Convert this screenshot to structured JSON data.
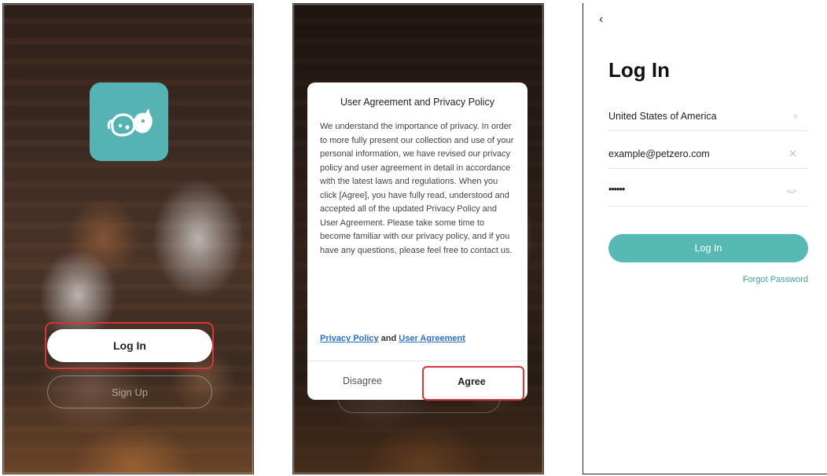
{
  "screens": {
    "welcome": {
      "login_label": "Log In",
      "signup_label": "Sign Up",
      "highlight_color": "#d4363c",
      "logo_color": "#56b3b4",
      "logo_icon": "dog-cat-icon"
    },
    "agreement": {
      "title": "User Agreement and Privacy Policy",
      "body": "We understand the importance of privacy. In order to more fully present our collection and use of your personal information, we have revised our privacy policy and user agreement in detail in accordance with the latest laws and regulations. When you click [Agree], you have fully read, understood and accepted all of the updated Privacy Policy and User Agreement. Please take some time to become familiar with our privacy policy, and if you have any questions, please feel free to contact us.",
      "privacy_link": "Privacy Policy",
      "and_text": "and",
      "agreement_link": "User Agreement",
      "disagree_label": "Disagree",
      "agree_label": "Agree",
      "link_color": "#2c6fc8"
    },
    "login": {
      "back_icon": "chevron-left-icon",
      "title": "Log In",
      "country": "United States of America",
      "email": "example@petzero.com",
      "password": "••••••",
      "login_label": "Log In",
      "forgot_label": "Forgot Password",
      "accent_color": "#57b9b4"
    }
  }
}
